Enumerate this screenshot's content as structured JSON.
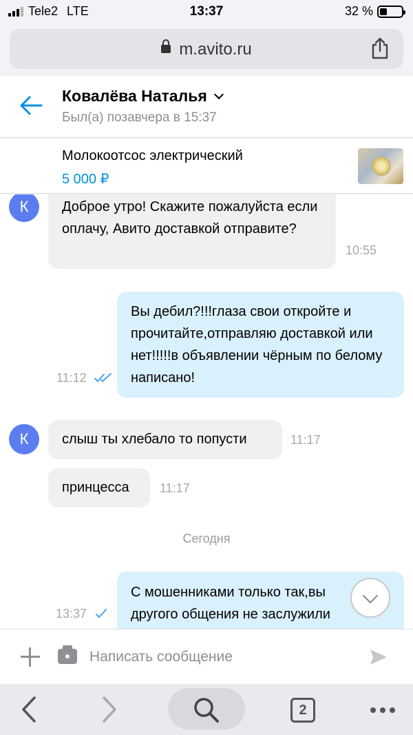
{
  "status_bar": {
    "carrier": "Tele2",
    "network": "LTE",
    "time": "13:37",
    "battery_text": "32 %",
    "battery_level": 0.32
  },
  "browser": {
    "url": "m.avito.ru",
    "tabs_count": "2"
  },
  "chat_header": {
    "name": "Ковалёва Наталья",
    "presence": "Был(а) позавчера в 15:37"
  },
  "item": {
    "title": "Молокоотсос электрический",
    "price": "5 000 ₽"
  },
  "messages": [
    {
      "direction": "in",
      "avatar": "К",
      "text": "Доброе утро! Скажите пожалуйста если оплачу, Авито доставкой отправите?",
      "time": "10:55"
    },
    {
      "direction": "out",
      "text": "Вы дебил?!!!глаза свои откройте и прочитайте,отправляю доставкой или нет!!!!!в объявлении чёрным по белому написано!",
      "time": "11:12",
      "status": "read"
    },
    {
      "direction": "in",
      "avatar": "К",
      "text": "слыш ты хлебало то попусти",
      "time": "11:17"
    },
    {
      "direction": "in",
      "text": "принцесса",
      "time": "11:17"
    },
    {
      "direction": "out",
      "text": "С мошенниками только так,вы другого общения не заслужили",
      "time": "13:37",
      "status": "sent"
    }
  ],
  "date_separator": "Сегодня",
  "composer": {
    "placeholder": "Написать сообщение"
  },
  "icons": {
    "back": "arrow-left-icon",
    "share": "share-icon",
    "lock": "lock-icon",
    "attach": "plus-icon",
    "camera": "camera-icon",
    "send": "send-icon",
    "scroll": "chevron-down-icon",
    "nav_back": "chevron-left-icon",
    "nav_forward": "chevron-right-icon",
    "search": "search-icon",
    "more": "more-icon"
  },
  "colors": {
    "accent": "#0091e4",
    "avatar": "#5b7df0",
    "incoming_bubble": "#f0f0f0",
    "outgoing_bubble": "#d9f0fd",
    "read_ticks": "#4aa3ef"
  }
}
